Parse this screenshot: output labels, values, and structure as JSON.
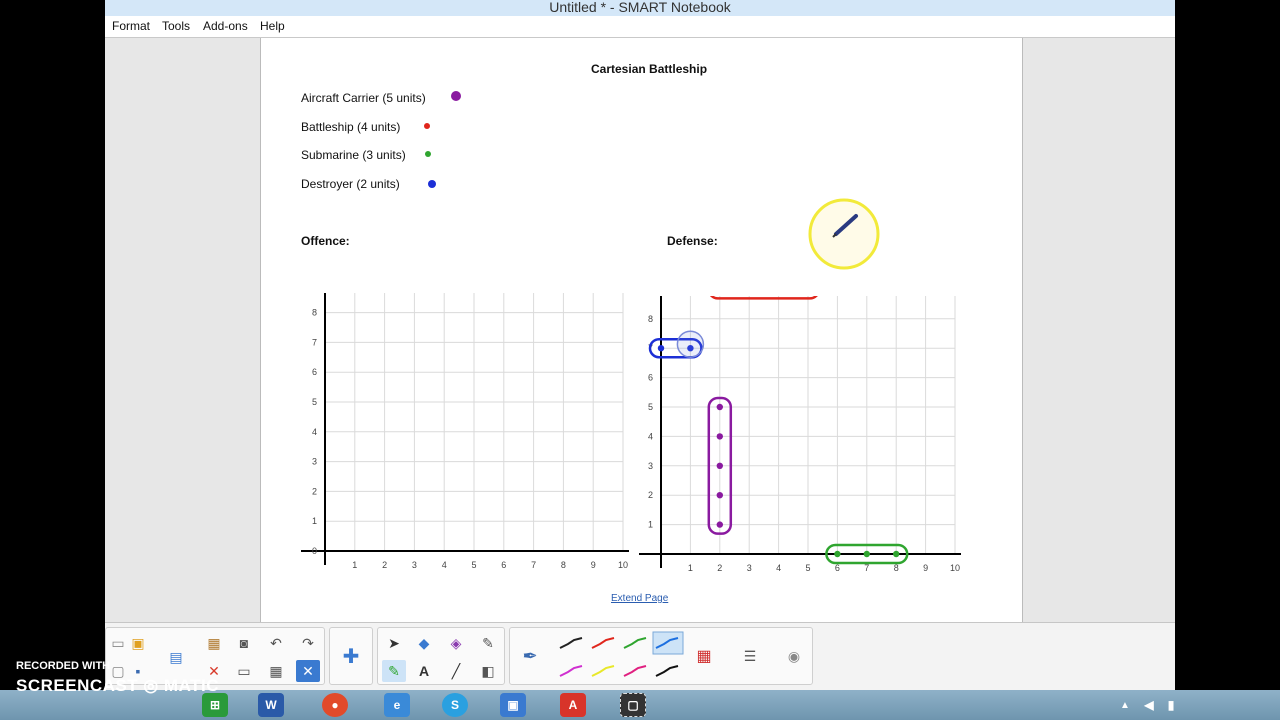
{
  "window": {
    "title": "Untitled * - SMART Notebook"
  },
  "menu": {
    "items": [
      "Format",
      "Tools",
      "Add-ons",
      "Help"
    ]
  },
  "page": {
    "title": "Cartesian Battleship",
    "ships": [
      {
        "label": "Aircraft Carrier (5 units)",
        "color": "#8a1aa0"
      },
      {
        "label": "Battleship (4 units)",
        "color": "#e0261c"
      },
      {
        "label": "Submarine (3 units)",
        "color": "#2fa52f"
      },
      {
        "label": "Destroyer (2 units)",
        "color": "#1c2fd6"
      }
    ],
    "offence_label": "Offence:",
    "defense_label": "Defense:",
    "extend_link": "Extend Page"
  },
  "grids": {
    "axis_labels": [
      "1",
      "2",
      "3",
      "4",
      "5",
      "6",
      "7",
      "8",
      "9",
      "10"
    ],
    "offence_origin_label": "0",
    "defense": {
      "battleship_points": [
        [
          2,
          9
        ],
        [
          3,
          9
        ],
        [
          4,
          9
        ],
        [
          5,
          9
        ]
      ],
      "destroyer_points": [
        [
          0,
          7
        ],
        [
          1,
          7
        ]
      ],
      "carrier_points": [
        [
          2,
          1
        ],
        [
          2,
          2
        ],
        [
          2,
          3
        ],
        [
          2,
          4
        ],
        [
          2,
          5
        ]
      ],
      "submarine_points": [
        [
          6,
          0
        ],
        [
          7,
          0
        ],
        [
          8,
          0
        ]
      ]
    }
  },
  "toolbar": {
    "pen_colors": [
      "#222222",
      "#e0261c",
      "#2fa52f",
      "#1c6fe0",
      "#d02fd0",
      "#e8e82a",
      "#e02080",
      "#111111"
    ]
  },
  "taskbar": {
    "apps": [
      "chrome-icon",
      "word-icon",
      "ie-icon",
      "skype-icon",
      "notebook-icon",
      "acrobat-icon",
      "snip-icon"
    ]
  },
  "watermark": {
    "line1": "RECORDED WITH",
    "line2": "SCREENCAST",
    "line3": "MATIC"
  }
}
